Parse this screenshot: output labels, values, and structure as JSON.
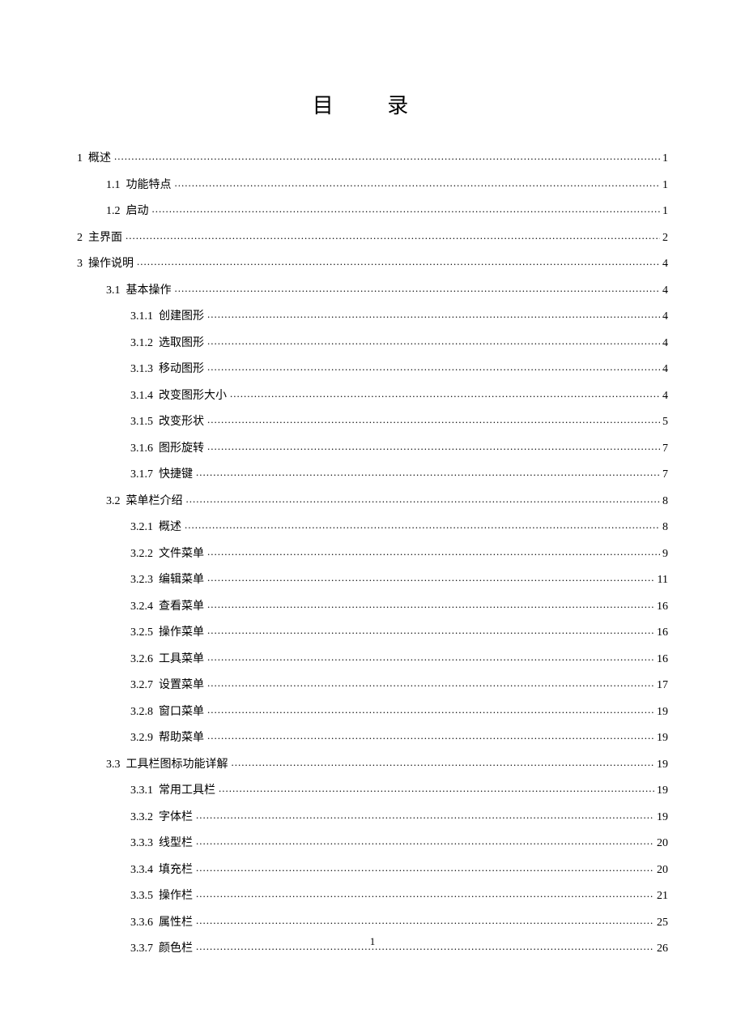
{
  "title": "目 录",
  "page_number": "1",
  "entries": [
    {
      "level": 0,
      "num": "1",
      "text": "概述",
      "page": "1"
    },
    {
      "level": 1,
      "num": "1.1",
      "text": "功能特点",
      "page": "1"
    },
    {
      "level": 1,
      "num": "1.2",
      "text": "启动",
      "page": "1"
    },
    {
      "level": 0,
      "num": "2",
      "text": "主界面",
      "page": "2"
    },
    {
      "level": 0,
      "num": "3",
      "text": "操作说明",
      "page": "4"
    },
    {
      "level": 1,
      "num": "3.1",
      "text": "基本操作",
      "page": "4"
    },
    {
      "level": 2,
      "num": "3.1.1",
      "text": "创建图形",
      "page": "4"
    },
    {
      "level": 2,
      "num": "3.1.2",
      "text": "选取图形",
      "page": "4"
    },
    {
      "level": 2,
      "num": "3.1.3",
      "text": "移动图形",
      "page": "4"
    },
    {
      "level": 2,
      "num": "3.1.4",
      "text": "改变图形大小",
      "page": "4"
    },
    {
      "level": 2,
      "num": "3.1.5",
      "text": "改变形状",
      "page": "5"
    },
    {
      "level": 2,
      "num": "3.1.6",
      "text": "图形旋转",
      "page": "7"
    },
    {
      "level": 2,
      "num": "3.1.7",
      "text": "快捷键",
      "page": "7"
    },
    {
      "level": 1,
      "num": "3.2",
      "text": "菜单栏介绍",
      "page": "8"
    },
    {
      "level": 2,
      "num": "3.2.1",
      "text": "概述",
      "page": "8"
    },
    {
      "level": 2,
      "num": "3.2.2",
      "text": "文件菜单",
      "page": "9"
    },
    {
      "level": 2,
      "num": "3.2.3",
      "text": "编辑菜单",
      "page": "11"
    },
    {
      "level": 2,
      "num": "3.2.4",
      "text": "查看菜单",
      "page": "16"
    },
    {
      "level": 2,
      "num": "3.2.5",
      "text": "操作菜单",
      "page": "16"
    },
    {
      "level": 2,
      "num": "3.2.6",
      "text": "工具菜单",
      "page": "16"
    },
    {
      "level": 2,
      "num": "3.2.7",
      "text": "设置菜单",
      "page": "17"
    },
    {
      "level": 2,
      "num": "3.2.8",
      "text": "窗口菜单",
      "page": "19"
    },
    {
      "level": 2,
      "num": "3.2.9",
      "text": "帮助菜单",
      "page": "19"
    },
    {
      "level": 1,
      "num": "3.3",
      "text": "工具栏图标功能详解",
      "page": "19"
    },
    {
      "level": 2,
      "num": "3.3.1",
      "text": "常用工具栏",
      "page": "19"
    },
    {
      "level": 2,
      "num": "3.3.2",
      "text": "字体栏",
      "page": "19"
    },
    {
      "level": 2,
      "num": "3.3.3",
      "text": "线型栏",
      "page": "20"
    },
    {
      "level": 2,
      "num": "3.3.4",
      "text": "填充栏",
      "page": "20"
    },
    {
      "level": 2,
      "num": "3.3.5",
      "text": "操作栏",
      "page": "21"
    },
    {
      "level": 2,
      "num": "3.3.6",
      "text": "属性栏",
      "page": "25"
    },
    {
      "level": 2,
      "num": "3.3.7",
      "text": "颜色栏",
      "page": "26"
    }
  ]
}
